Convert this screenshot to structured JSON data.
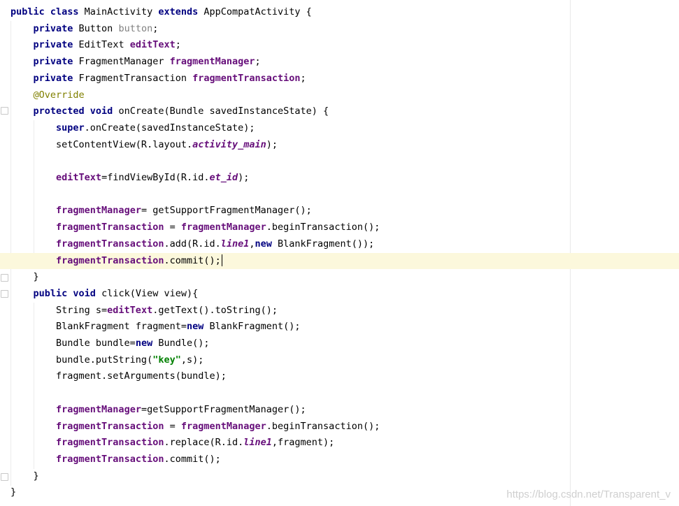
{
  "editor": {
    "lines": [
      {
        "t": [
          [
            "kw",
            "public class "
          ],
          [
            "",
            "MainActivity "
          ],
          [
            "kw",
            "extends "
          ],
          [
            "",
            "AppCompatActivity {"
          ]
        ]
      },
      {
        "t": [
          [
            "",
            "    "
          ],
          [
            "kw",
            "private "
          ],
          [
            "",
            "Button "
          ],
          [
            "fld-gray",
            "button"
          ],
          [
            "",
            ";"
          ]
        ]
      },
      {
        "t": [
          [
            "",
            "    "
          ],
          [
            "kw",
            "private "
          ],
          [
            "",
            "EditText "
          ],
          [
            "fld",
            "editText"
          ],
          [
            "",
            ";"
          ]
        ]
      },
      {
        "t": [
          [
            "",
            "    "
          ],
          [
            "kw",
            "private "
          ],
          [
            "",
            "FragmentManager "
          ],
          [
            "fld",
            "fragmentManager"
          ],
          [
            "",
            ";"
          ]
        ]
      },
      {
        "t": [
          [
            "",
            "    "
          ],
          [
            "kw",
            "private "
          ],
          [
            "",
            "FragmentTransaction "
          ],
          [
            "fld",
            "fragmentTransaction"
          ],
          [
            "",
            ";"
          ]
        ]
      },
      {
        "t": [
          [
            "",
            "    "
          ],
          [
            "ann",
            "@Override"
          ]
        ]
      },
      {
        "t": [
          [
            "",
            "    "
          ],
          [
            "kw",
            "protected void "
          ],
          [
            "",
            "onCreate(Bundle savedInstanceState) {"
          ]
        ]
      },
      {
        "t": [
          [
            "",
            "        "
          ],
          [
            "kw",
            "super"
          ],
          [
            "",
            ".onCreate(savedInstanceState);"
          ]
        ]
      },
      {
        "t": [
          [
            "",
            "        setContentView(R.layout."
          ],
          [
            "stfld",
            "activity_main"
          ],
          [
            "",
            ");"
          ]
        ]
      },
      {
        "t": [
          [
            "",
            ""
          ]
        ]
      },
      {
        "t": [
          [
            "",
            "        "
          ],
          [
            "fld",
            "editText"
          ],
          [
            "",
            "=findViewById(R.id."
          ],
          [
            "stfld",
            "et_id"
          ],
          [
            "",
            ");"
          ]
        ]
      },
      {
        "t": [
          [
            "",
            ""
          ]
        ]
      },
      {
        "t": [
          [
            "",
            "        "
          ],
          [
            "fld",
            "fragmentManager"
          ],
          [
            "",
            "= getSupportFragmentManager();"
          ]
        ]
      },
      {
        "t": [
          [
            "",
            "        "
          ],
          [
            "fld",
            "fragmentTransaction"
          ],
          [
            "",
            " = "
          ],
          [
            "fld",
            "fragmentManager"
          ],
          [
            "",
            ".beginTransaction();"
          ]
        ]
      },
      {
        "t": [
          [
            "",
            "        "
          ],
          [
            "fld",
            "fragmentTransaction"
          ],
          [
            "",
            ".add(R.id."
          ],
          [
            "stfld",
            "line1"
          ],
          [
            "",
            ","
          ],
          [
            "kw",
            "new "
          ],
          [
            "",
            "BlankFragment());"
          ]
        ]
      },
      {
        "t": [
          [
            "",
            "        "
          ],
          [
            "fld",
            "fragmentTransaction"
          ],
          [
            "",
            ".commit();"
          ]
        ],
        "current": true
      },
      {
        "t": [
          [
            "",
            "    }"
          ]
        ]
      },
      {
        "t": [
          [
            "",
            "    "
          ],
          [
            "kw",
            "public void "
          ],
          [
            "",
            "click(View view){"
          ]
        ]
      },
      {
        "t": [
          [
            "",
            "        String s="
          ],
          [
            "fld",
            "editText"
          ],
          [
            "",
            ".getText().toString();"
          ]
        ]
      },
      {
        "t": [
          [
            "",
            "        BlankFragment fragment="
          ],
          [
            "kw",
            "new "
          ],
          [
            "",
            "BlankFragment();"
          ]
        ]
      },
      {
        "t": [
          [
            "",
            "        Bundle bundle="
          ],
          [
            "kw",
            "new "
          ],
          [
            "",
            "Bundle();"
          ]
        ]
      },
      {
        "t": [
          [
            "",
            "        bundle.putString("
          ],
          [
            "str",
            "\"key\""
          ],
          [
            "",
            ",s);"
          ]
        ]
      },
      {
        "t": [
          [
            "",
            "        fragment.setArguments(bundle);"
          ]
        ]
      },
      {
        "t": [
          [
            "",
            ""
          ]
        ]
      },
      {
        "t": [
          [
            "",
            "        "
          ],
          [
            "fld",
            "fragmentManager"
          ],
          [
            "",
            "=getSupportFragmentManager();"
          ]
        ]
      },
      {
        "t": [
          [
            "",
            "        "
          ],
          [
            "fld",
            "fragmentTransaction"
          ],
          [
            "",
            " = "
          ],
          [
            "fld",
            "fragmentManager"
          ],
          [
            "",
            ".beginTransaction();"
          ]
        ]
      },
      {
        "t": [
          [
            "",
            "        "
          ],
          [
            "fld",
            "fragmentTransaction"
          ],
          [
            "",
            ".replace(R.id."
          ],
          [
            "stfld",
            "line1"
          ],
          [
            "",
            ",fragment);"
          ]
        ]
      },
      {
        "t": [
          [
            "",
            "        "
          ],
          [
            "fld",
            "fragmentTransaction"
          ],
          [
            "",
            ".commit();"
          ]
        ]
      },
      {
        "t": [
          [
            "",
            "    }"
          ]
        ]
      },
      {
        "t": [
          [
            "",
            "}"
          ]
        ]
      }
    ]
  },
  "watermark": "https://blog.csdn.net/Transparent_v"
}
